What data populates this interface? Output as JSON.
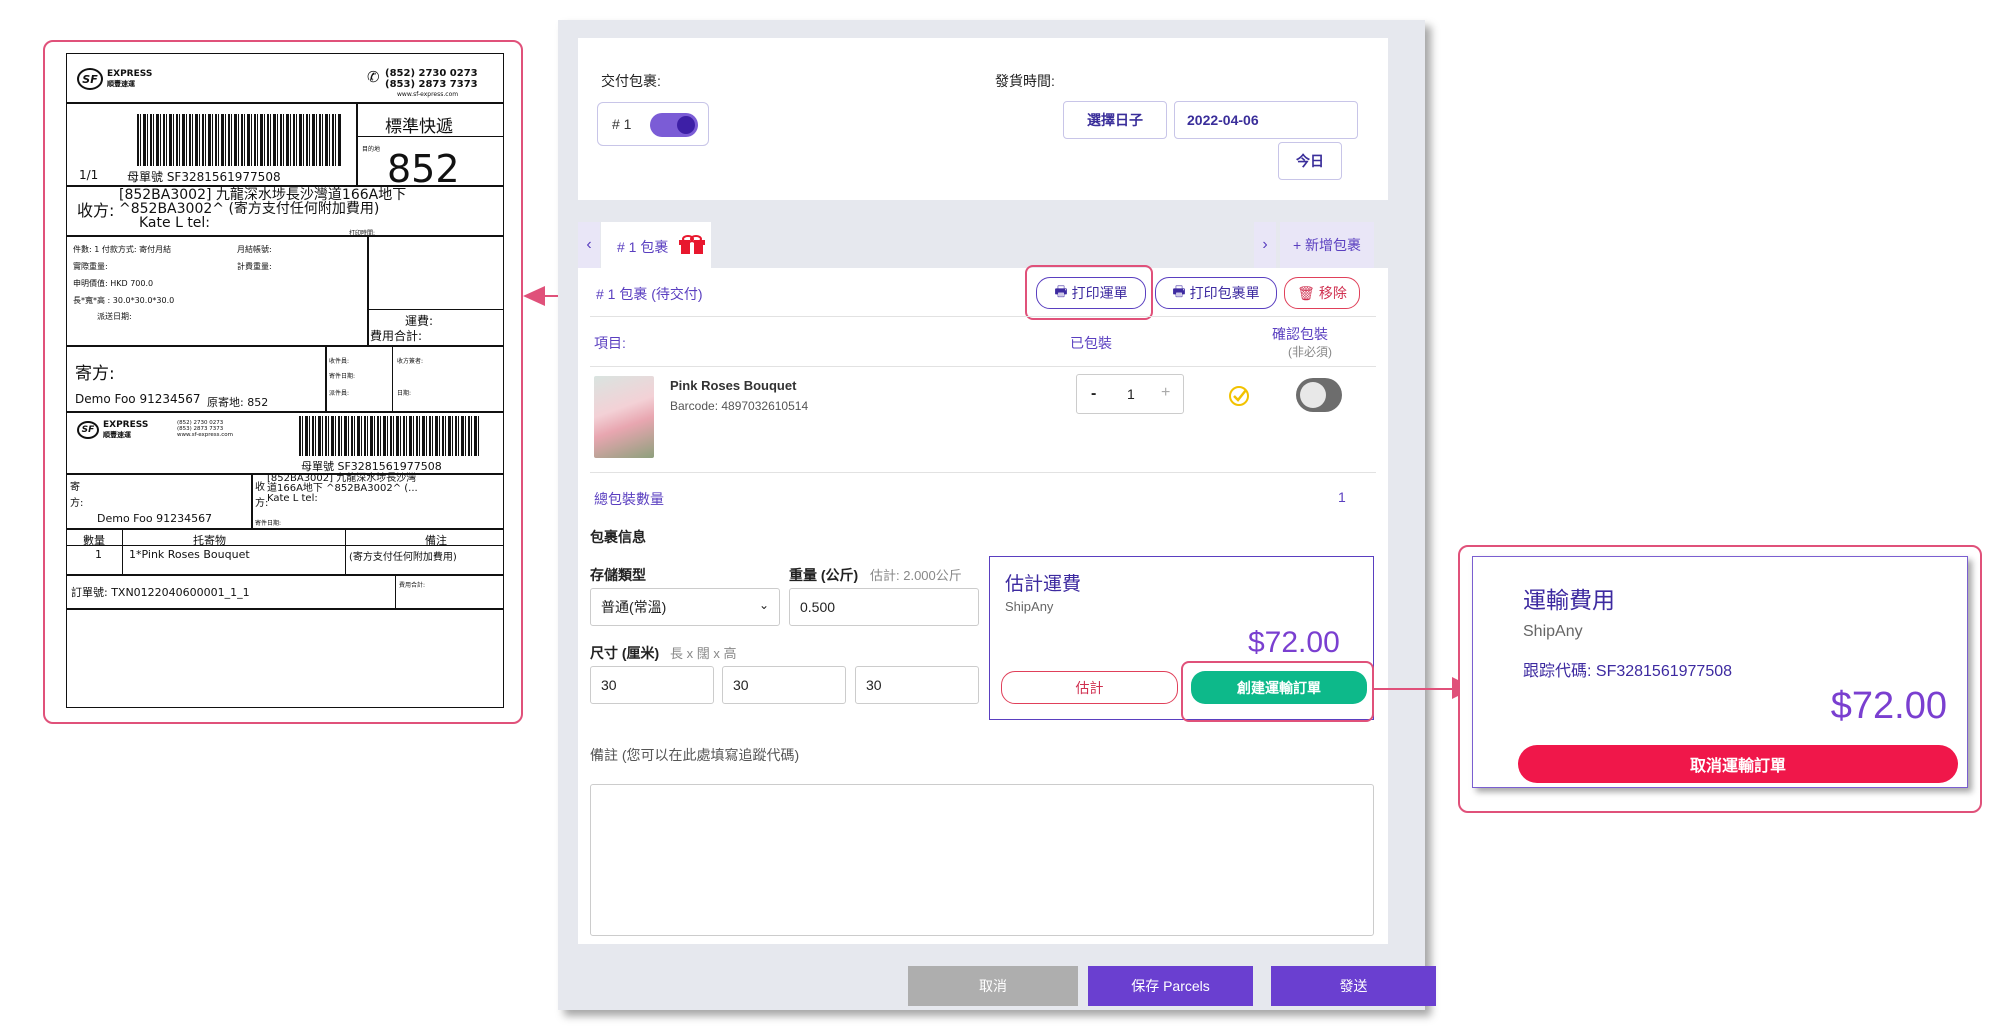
{
  "label": {
    "logo_main": "EXPRESS",
    "logo_sub": "順豐速運",
    "phone1": "(852) 2730 0273",
    "phone2": "(853) 2873 7373",
    "website": "www.sf-express.com",
    "service": "標準快遞",
    "dest_caption": "目的地",
    "dest_code": "852",
    "page": "1/1",
    "master_no": "母單號 SF3281561977508",
    "recipient_title": "收方:",
    "recipient_line1": "[852BA3002] 九龍深水埗長沙灣道166A地下",
    "recipient_line2": "^852BA3002^ (寄方支付任何附加費用)",
    "recipient_line3": "Kate L tel:",
    "print_time": "打印時間:",
    "info1": "件數: 1  付款方式: 寄付月結",
    "info1b": "月結帳號:",
    "info2": "實際重量:",
    "info2b": "計費重量:",
    "info3": "申明價值: HKD 700.0",
    "info4": "長*寬*高 : 30.0*30.0*30.0",
    "info5": "派送日期:",
    "freight": "運費:",
    "total_fee": "費用合計:",
    "sender_title": "寄方:",
    "sender_name": "Demo Foo 91234567",
    "origin": "原寄地: 852",
    "collector": "收件員:",
    "collect_date": "寄件日期:",
    "deliverer": "派件員:",
    "signature": "收方簽者:",
    "date": "日期:",
    "master_no2": "母單號 SF3281561977508",
    "sender_short": "寄",
    "sender_short2": "方:",
    "sender_name2": "Demo Foo 91234567",
    "recv_short": "收",
    "recv_short2": "方:",
    "recv_addr1": "[852BA3002] 九龍深水埗長沙灣",
    "recv_addr2": "道166A地下 ^852BA3002^ (...",
    "recv_addr3": "Kate L tel:",
    "send_date": "寄件日期:",
    "col_qty": "數量",
    "col_item": "托寄物",
    "col_remark": "備注",
    "row_qty": "1",
    "row_item": "1*Pink Roses Bouquet",
    "row_remark": "(寄方支付任何附加費用)",
    "order_no": "訂單號: TXN0122040600001_1_1",
    "total_fee2": "費用合計:"
  },
  "form": {
    "deliver_label": "交付包裹:",
    "parcel_toggle": "# 1",
    "ship_time_label": "發貨時間:",
    "choose_date": "選擇日子",
    "date_value": "2022-04-06",
    "today": "今日",
    "tab_label": "# 1 包裹",
    "add_parcel": "+ 新增包裹",
    "parcel_title": "# 1 包裹 (待交付)",
    "print_waybill": "打印運單",
    "print_parcel": "打印包裹單",
    "remove": "移除",
    "col_item": "項目:",
    "col_packed": "已包裝",
    "col_confirm": "確認包裝",
    "col_confirm_sub": "(非必須)",
    "product_name": "Pink Roses Bouquet",
    "product_barcode": "Barcode: 4897032610514",
    "qty_minus": "-",
    "qty_value": "1",
    "qty_plus": "+",
    "total_qty_label": "總包裝數量",
    "total_qty": "1",
    "parcel_info": "包裹信息",
    "storage_label": "存儲類型",
    "storage_value": "普通(常溫)",
    "weight_label": "重量 (公斤)",
    "weight_hint": "估計: 2.000公斤",
    "weight_value": "0.500",
    "size_label": "尺寸 (厘米)",
    "size_hint": "長 x 闊 x 高",
    "size_l": "30",
    "size_w": "30",
    "size_h": "30",
    "est_title": "估計運費",
    "est_provider": "ShipAny",
    "est_price": "$72.00",
    "estimate_btn": "估計",
    "create_btn": "創建運輸訂單",
    "remark_label": "備註 (您可以在此處填寫追蹤代碼)",
    "cancel": "取消",
    "save": "保存 Parcels",
    "send": "發送"
  },
  "cost": {
    "title": "運輸費用",
    "provider": "ShipAny",
    "tracking": "跟踪代碼: SF3281561977508",
    "price": "$72.00",
    "cancel_order": "取消運輸訂單"
  },
  "colors": {
    "accent_purple": "#6a3fd0",
    "highlight_pink": "#e0517a",
    "green": "#0db98a",
    "red_button": "#f0174a",
    "price_purple": "#7a3fd0"
  }
}
